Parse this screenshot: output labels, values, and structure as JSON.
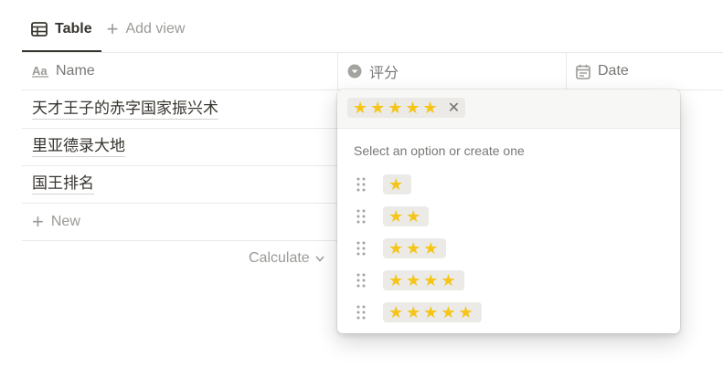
{
  "views": {
    "active_tab": "Table",
    "add_view": "Add view"
  },
  "table": {
    "columns": [
      {
        "label": "Name",
        "icon": "text-aa-icon"
      },
      {
        "label": "评分",
        "icon": "select-chevron-icon"
      },
      {
        "label": "Date",
        "icon": "calendar-icon"
      }
    ],
    "rows": [
      {
        "name": "天才王子的赤字国家振兴术"
      },
      {
        "name": "里亚德录大地"
      },
      {
        "name": "国王排名"
      }
    ],
    "new_label": "New",
    "calculate_label": "Calculate"
  },
  "dropdown": {
    "selected": {
      "stars": "★★★★★",
      "count": 5
    },
    "hint": "Select an option or create one",
    "options": [
      {
        "stars": "★",
        "count": 1
      },
      {
        "stars": "★★",
        "count": 2
      },
      {
        "stars": "★★★",
        "count": 3
      },
      {
        "stars": "★★★★",
        "count": 4
      },
      {
        "stars": "★★★★★",
        "count": 5
      }
    ]
  },
  "colors": {
    "star": "#f5c518",
    "tag_bg": "#ebeae7",
    "muted_text": "#787774",
    "border": "#e9e9e7"
  }
}
